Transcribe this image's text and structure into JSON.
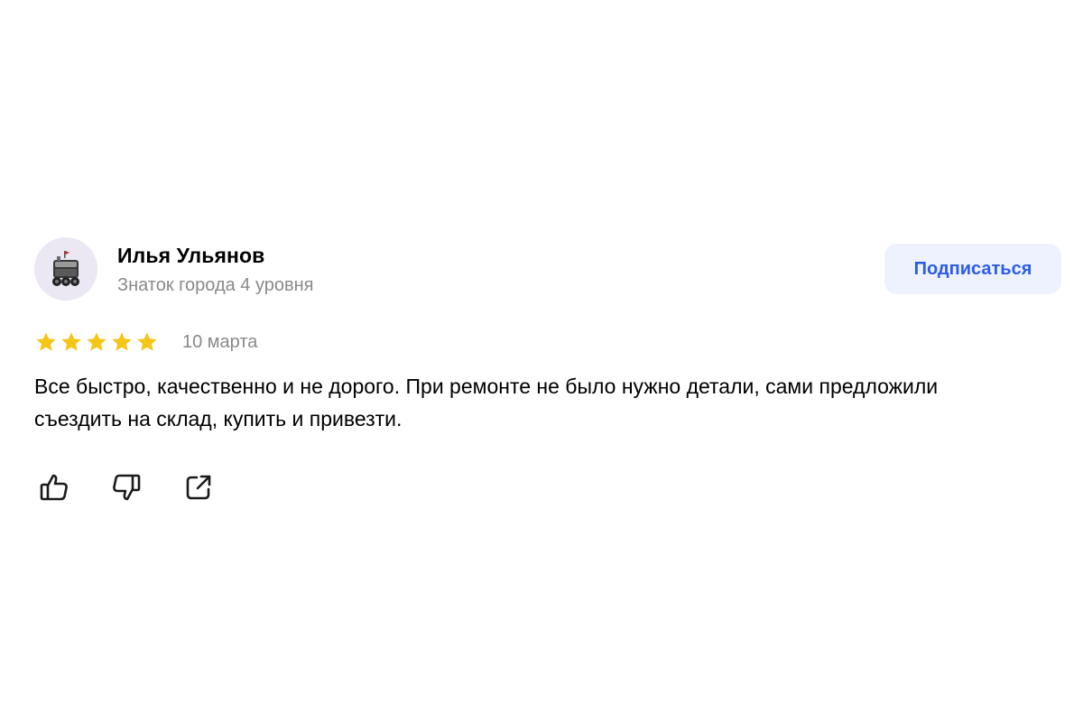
{
  "review": {
    "author": {
      "name": "Илья Ульянов",
      "level": "Знаток города 4 уровня",
      "avatar_icon": "robot-avatar-icon"
    },
    "subscribe_label": "Подписаться",
    "rating": 5,
    "rating_max": 5,
    "date": "10 марта",
    "text": "Все быстро, качественно и не дорого. При ремонте не было нужно детали, сами предложили съездить на склад, купить и привезти.",
    "actions": [
      {
        "icon": "thumbs-up-icon"
      },
      {
        "icon": "thumbs-down-icon"
      },
      {
        "icon": "share-icon"
      }
    ]
  },
  "colors": {
    "star": "#F5C518",
    "accent": "#2C5CE8",
    "button_bg": "#EEF2FE",
    "muted_text": "#898989"
  }
}
